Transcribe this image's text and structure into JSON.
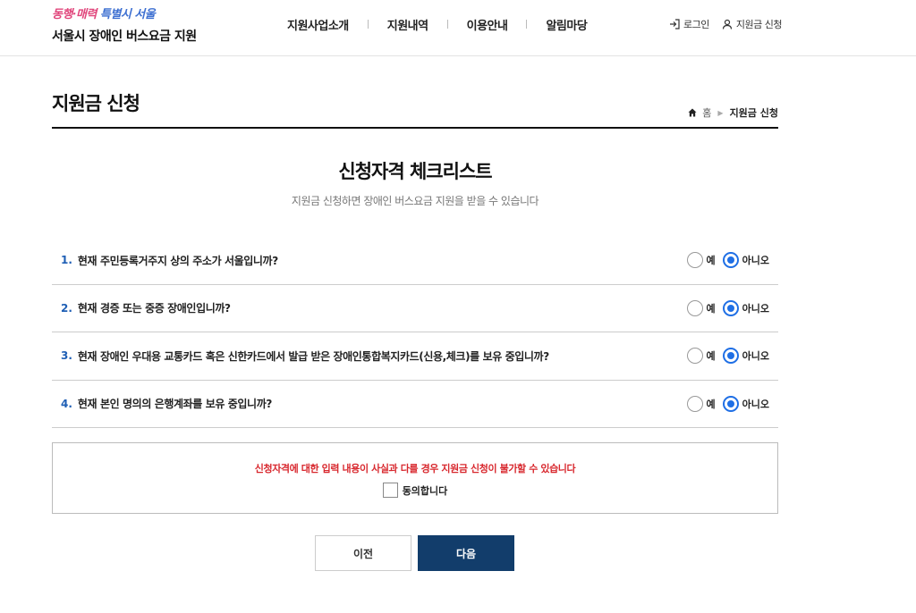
{
  "header": {
    "slogan_part1": "동행·매력",
    "slogan_part2": "특별시 서울",
    "site_title": "서울시 장애인 버스요금 지원",
    "nav": [
      {
        "label": "지원사업소개"
      },
      {
        "label": "지원내역"
      },
      {
        "label": "이용안내"
      },
      {
        "label": "알림마당"
      }
    ],
    "util": {
      "login_label": "로그인",
      "apply_label": "지원금 신청",
      "login_icon": "login-icon",
      "user_icon": "user-icon"
    }
  },
  "page": {
    "title": "지원금 신청",
    "breadcrumb": {
      "home_label": "홈",
      "current": "지원금 신청"
    }
  },
  "checklist": {
    "title": "신청자격 체크리스트",
    "description": "지원금 신청하면 장애인 버스요금 지원을 받을 수 있습니다",
    "yes_label": "예",
    "no_label": "아니오",
    "questions": [
      {
        "num": "1.",
        "text": "현재 주민등록거주지 상의 주소가 서울입니까?",
        "answer": "no"
      },
      {
        "num": "2.",
        "text": "현재 경증 또는 중증 장애인입니까?",
        "answer": "no"
      },
      {
        "num": "3.",
        "text": "현재 장애인 우대용 교통카드 혹은 신한카드에서 발급 받은 장애인통합복지카드(신용,체크)를 보유 중입니까?",
        "answer": "no"
      },
      {
        "num": "4.",
        "text": "현재 본인 명의의 은행계좌를 보유 중입니까?",
        "answer": "no"
      }
    ]
  },
  "notice": {
    "warning": "신청자격에 대한 입력 내용이 사실과 다를 경우 지원금 신청이 불가할 수 있습니다",
    "agree_label": "동의합니다",
    "agree_checked": false
  },
  "buttons": {
    "prev_label": "이전",
    "next_label": "다음"
  },
  "colors": {
    "accent_blue": "#1f6fe5",
    "question_number": "#1f5fb5",
    "next_button": "#123d6b",
    "warning_red": "#d8282e",
    "slogan_pink": "#e0457b",
    "slogan_blue": "#3d6fd1"
  }
}
